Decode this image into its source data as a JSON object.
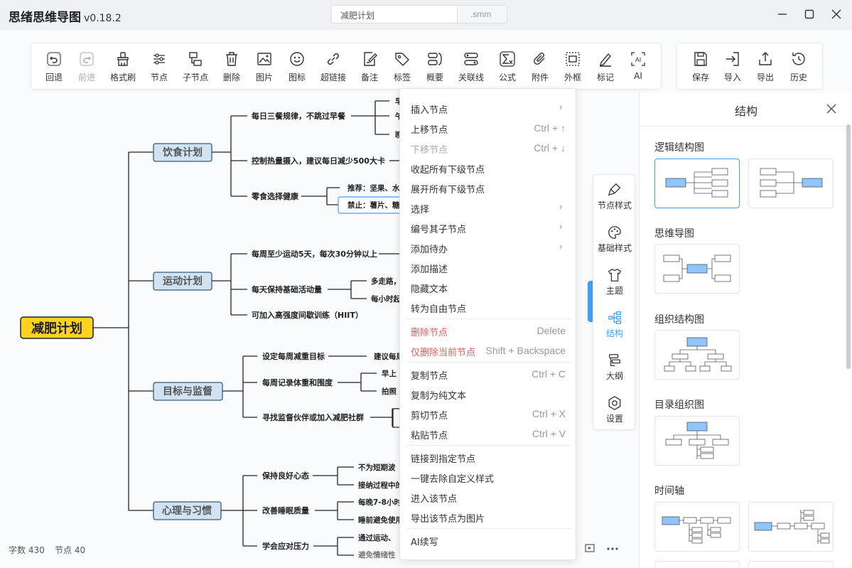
{
  "app": {
    "title": "思绪思维导图",
    "version": "v0.18.2"
  },
  "file": {
    "name": "减肥计划",
    "ext": ".smm"
  },
  "toolbar": {
    "items": [
      {
        "label": "回退",
        "icon": "undo-icon",
        "disabled": false
      },
      {
        "label": "前进",
        "icon": "redo-icon",
        "disabled": true
      },
      {
        "label": "格式刷",
        "icon": "format-brush-icon",
        "disabled": false
      },
      {
        "label": "节点",
        "icon": "node-icon",
        "disabled": false
      },
      {
        "label": "子节点",
        "icon": "child-node-icon",
        "disabled": false
      },
      {
        "label": "删除",
        "icon": "trash-icon",
        "disabled": false
      },
      {
        "label": "图片",
        "icon": "image-icon",
        "disabled": false
      },
      {
        "label": "图标",
        "icon": "emoji-icon",
        "disabled": false
      },
      {
        "label": "超链接",
        "icon": "link-icon",
        "disabled": false
      },
      {
        "label": "备注",
        "icon": "note-icon",
        "disabled": false
      },
      {
        "label": "标签",
        "icon": "tag-icon",
        "disabled": false
      },
      {
        "label": "概要",
        "icon": "summary-icon",
        "disabled": false
      },
      {
        "label": "关联线",
        "icon": "association-line-icon",
        "disabled": false
      },
      {
        "label": "公式",
        "icon": "formula-icon",
        "disabled": false
      },
      {
        "label": "附件",
        "icon": "attachment-icon",
        "disabled": false
      },
      {
        "label": "外框",
        "icon": "outer-frame-icon",
        "disabled": false
      },
      {
        "label": "标记",
        "icon": "pen-icon",
        "disabled": false
      },
      {
        "label": "AI",
        "icon": "ai-icon",
        "disabled": false
      }
    ],
    "right_items": [
      {
        "label": "保存",
        "icon": "save-icon"
      },
      {
        "label": "导入",
        "icon": "import-icon"
      },
      {
        "label": "导出",
        "icon": "export-icon"
      },
      {
        "label": "历史",
        "icon": "history-icon"
      }
    ]
  },
  "mindmap": {
    "root": "减肥计划",
    "branches": [
      {
        "label": "饮食计划",
        "children": [
          {
            "label": "每日三餐规律，不跳过早餐",
            "children": [
              "早",
              "午",
              "晚"
            ]
          },
          {
            "label": "控制热量摄入，建议每日减少500大卡",
            "children": []
          },
          {
            "label": "零食选择健康",
            "children": [
              "推荐：坚果、水",
              "禁止：薯片、糖"
            ]
          }
        ]
      },
      {
        "label": "运动计划",
        "children": [
          {
            "label": "每周至少运动5天，每次30分钟以上",
            "children": []
          },
          {
            "label": "每天保持基础活动量",
            "children": [
              "多走路，",
              "每小时起"
            ]
          },
          {
            "label": "可加入高强度间歇训练（HIIT）",
            "children": []
          }
        ]
      },
      {
        "label": "目标与监督",
        "children": [
          {
            "label": "设定每周减重目标",
            "children": [
              "建议每周"
            ]
          },
          {
            "label": "每周记录体重和围度",
            "children": [
              "早上",
              "拍照"
            ]
          },
          {
            "label": "寻找监督伙伴或加入减肥社群",
            "children": []
          }
        ]
      },
      {
        "label": "心理与习惯",
        "children": [
          {
            "label": "保持良好心态",
            "children": [
              "不为短期波",
              "接纳过程中的"
            ]
          },
          {
            "label": "改善睡眠质量",
            "children": [
              "每晚7-8小时",
              "睡前避免使用"
            ]
          },
          {
            "label": "学会应对压力",
            "children": [
              "通过运动、",
              "避免情绪性"
            ]
          }
        ]
      }
    ]
  },
  "context_menu": {
    "items": [
      {
        "label": "插入节点",
        "shortcut": "",
        "submenu": true,
        "state": "normal"
      },
      {
        "label": "上移节点",
        "shortcut": "Ctrl + ↑",
        "submenu": false,
        "state": "normal"
      },
      {
        "label": "下移节点",
        "shortcut": "Ctrl + ↓",
        "submenu": false,
        "state": "disabled"
      },
      {
        "label": "收起所有下级节点",
        "shortcut": "",
        "submenu": false,
        "state": "normal"
      },
      {
        "label": "展开所有下级节点",
        "shortcut": "",
        "submenu": false,
        "state": "normal"
      },
      {
        "label": "选择",
        "shortcut": "",
        "submenu": true,
        "state": "normal"
      },
      {
        "label": "编号其子节点",
        "shortcut": "",
        "submenu": true,
        "state": "normal"
      },
      {
        "label": "添加待办",
        "shortcut": "",
        "submenu": true,
        "state": "normal"
      },
      {
        "label": "添加描述",
        "shortcut": "",
        "submenu": false,
        "state": "normal"
      },
      {
        "label": "隐藏文本",
        "shortcut": "",
        "submenu": false,
        "state": "normal"
      },
      {
        "label": "转为自由节点",
        "shortcut": "",
        "submenu": false,
        "state": "normal"
      },
      {
        "label": "删除节点",
        "shortcut": "Delete",
        "submenu": false,
        "state": "danger"
      },
      {
        "label": "仅删除当前节点",
        "shortcut": "Shift + Backspace",
        "submenu": false,
        "state": "danger"
      },
      {
        "label": "复制节点",
        "shortcut": "Ctrl + C",
        "submenu": false,
        "state": "normal"
      },
      {
        "label": "复制为纯文本",
        "shortcut": "",
        "submenu": false,
        "state": "normal"
      },
      {
        "label": "剪切节点",
        "shortcut": "Ctrl + X",
        "submenu": false,
        "state": "normal"
      },
      {
        "label": "粘贴节点",
        "shortcut": "Ctrl + V",
        "submenu": false,
        "state": "normal"
      },
      {
        "label": "链接到指定节点",
        "shortcut": "",
        "submenu": false,
        "state": "normal"
      },
      {
        "label": "一键去除自定义样式",
        "shortcut": "",
        "submenu": false,
        "state": "normal"
      },
      {
        "label": "进入该节点",
        "shortcut": "",
        "submenu": false,
        "state": "normal"
      },
      {
        "label": "导出该节点为图片",
        "shortcut": "",
        "submenu": false,
        "state": "normal"
      },
      {
        "label": "AI续写",
        "shortcut": "",
        "submenu": false,
        "state": "normal"
      }
    ]
  },
  "sidebox": {
    "items": [
      {
        "label": "节点样式",
        "icon": "node-style-icon",
        "active": false
      },
      {
        "label": "基础样式",
        "icon": "palette-icon",
        "active": false
      },
      {
        "label": "主题",
        "icon": "theme-shirt-icon",
        "active": false
      },
      {
        "label": "结构",
        "icon": "structure-icon",
        "active": true
      },
      {
        "label": "大纲",
        "icon": "outline-icon",
        "active": false
      },
      {
        "label": "设置",
        "icon": "settings-icon",
        "active": false
      }
    ]
  },
  "structure_panel": {
    "title": "结构",
    "sections": [
      "逻辑结构图",
      "思维导图",
      "组织结构图",
      "目录组织图",
      "时间轴"
    ]
  },
  "footer": {
    "word_count_label": "字数",
    "word_count": "430",
    "node_count_label": "节点",
    "node_count": "40"
  },
  "colors": {
    "accent": "#409eff",
    "root_fill": "#ffd21f",
    "branch_fill": "#cfe3f2",
    "branch_border": "#3a5a73",
    "danger": "#e25c5c"
  }
}
